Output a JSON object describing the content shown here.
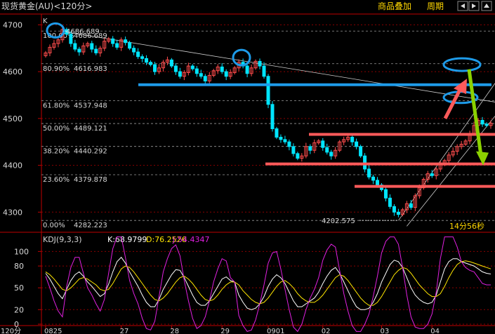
{
  "header": {
    "title": "现货黄金(AU)<120分>",
    "buttons": [
      "商品叠加",
      "周期"
    ],
    "nav_icons": [
      "arrow-left-icon",
      "arrow-right-icon",
      "arrow-up-icon"
    ]
  },
  "main_panel": {
    "corner_label": "K",
    "countdown": "14分56秒"
  },
  "colors": {
    "background": "#000000",
    "frame": "#c00000",
    "grid": "#8b0000",
    "candle_up": "#ff4d4d",
    "candle_down": "#00e5ff",
    "fib_line": "#9a9a9a",
    "axis_text": "#d8d8d8",
    "header_text": "#d8d8d8",
    "header_button": "#ffd700",
    "annotation_blue": "#1e9be9",
    "annotation_red": "#ff5a5a",
    "annotation_green": "#8bd100",
    "k_line": "#ffffff",
    "d_line": "#ffe600",
    "j_line": "#e020e0"
  },
  "chart_data": [
    {
      "type": "candlestick",
      "title": "现货黄金(AU)<120分>",
      "xlabel": "",
      "ylabel": "",
      "ylim": [
        4260,
        4720
      ],
      "y_ticks": [
        4300,
        4400,
        4500,
        4600,
        4700
      ],
      "x_ticks": [
        "0825",
        "27",
        "28",
        "29",
        "0901",
        "02",
        "03",
        "04"
      ],
      "period_label": "120分",
      "grid": true,
      "fibonacci_levels": [
        {
          "label": "100.00%",
          "value": 4686.689,
          "value_label": "4686.689"
        },
        {
          "label": "80.90%",
          "value": 4616.983,
          "value_label": "4616.983"
        },
        {
          "label": "61.80%",
          "value": 4537.948,
          "value_label": "4537.948"
        },
        {
          "label": "50.00%",
          "value": 4489.121,
          "value_label": "4489.121"
        },
        {
          "label": "38.20%",
          "value": 4440.292,
          "value_label": "4440.292"
        },
        {
          "label": "23.60%",
          "value": 4379.878,
          "value_label": "4379.878"
        },
        {
          "label": "0.00%",
          "value": 4282.223,
          "value_label": "4282.223"
        }
      ],
      "point_labels": [
        {
          "text": "4686.689",
          "value": 4686.689
        },
        {
          "text": "4202.575",
          "value": 4282.223
        }
      ],
      "series": [
        {
          "name": "",
          "close": [
            4640,
            4652,
            4660,
            4668,
            4690,
            4680,
            4660,
            4648,
            4642,
            4655,
            4660,
            4648,
            4640,
            4650,
            4665,
            4670,
            4660,
            4652,
            4668,
            4662,
            4650,
            4642,
            4632,
            4628,
            4620,
            4615,
            4600,
            4608,
            4620,
            4625,
            4612,
            4600,
            4590,
            4598,
            4612,
            4606,
            4596,
            4590,
            4580,
            4592,
            4602,
            4610,
            4600,
            4590,
            4598,
            4608,
            4620,
            4612,
            4596,
            4608,
            4622,
            4612,
            4590,
            4530,
            4478,
            4460,
            4455,
            4450,
            4440,
            4425,
            4415,
            4420,
            4440,
            4432,
            4448,
            4452,
            4438,
            4428,
            4420,
            4432,
            4450,
            4455,
            4460,
            4450,
            4440,
            4420,
            4392,
            4375,
            4368,
            4358,
            4348,
            4330,
            4312,
            4300,
            4295,
            4305,
            4318,
            4310,
            4335,
            4352,
            4370,
            4382,
            4378,
            4392,
            4402,
            4410,
            4422,
            4430,
            4440,
            4445,
            4452,
            4468,
            4485,
            4496,
            4488,
            4485,
            4490
          ]
        }
      ],
      "annotations": {
        "horizontal_levels": [
          {
            "color": "blue",
            "value": 4572
          },
          {
            "color": "red",
            "value": 4466
          },
          {
            "color": "red",
            "value": 4403
          },
          {
            "color": "red",
            "value": 4355
          }
        ],
        "ellipses": [
          {
            "color": "blue",
            "at": "100.00% level",
            "value": 4688
          },
          {
            "color": "blue",
            "at": "2nd high",
            "value": 4630
          },
          {
            "color": "blue",
            "at": "target upper",
            "value": 4615
          },
          {
            "color": "blue",
            "at": "target lower",
            "value": 4545
          }
        ],
        "arrows": [
          {
            "color": "red",
            "direction": "up",
            "from_value": 4500,
            "to_value": 4585
          },
          {
            "color": "green",
            "direction": "down",
            "from_value": 4605,
            "to_value": 4400
          }
        ]
      }
    },
    {
      "type": "line",
      "title": "KDJ(9,3,3)",
      "indicator_label": "KDJ(9,3,3)",
      "ylim": [
        0,
        110
      ],
      "y_ticks": [
        0,
        20,
        50,
        80,
        100
      ],
      "grid": true,
      "legend": [
        {
          "label": "K:",
          "value": "68.9799"
        },
        {
          "label": "D:",
          "value": "76.2526"
        },
        {
          "label": "J:",
          "value": "54.4347"
        }
      ],
      "series": [
        {
          "name": "K",
          "values": [
            70,
            62,
            52,
            42,
            35,
            48,
            60,
            68,
            72,
            66,
            58,
            52,
            45,
            38,
            42,
            55,
            72,
            86,
            92,
            84,
            72,
            62,
            52,
            40,
            30,
            24,
            24,
            34,
            48,
            58,
            68,
            75,
            74,
            64,
            52,
            40,
            30,
            26,
            26,
            32,
            42,
            52,
            62,
            65,
            60,
            58,
            40,
            30,
            22,
            20,
            22,
            28,
            38,
            52,
            62,
            68,
            64,
            56,
            44,
            32,
            24,
            24,
            28,
            32,
            36,
            44,
            56,
            66,
            74,
            78,
            70,
            58,
            46,
            34,
            24,
            20,
            20,
            22,
            30,
            42,
            58,
            70,
            82,
            88,
            86,
            78,
            64,
            50,
            40,
            34,
            30,
            28,
            30,
            40,
            58,
            76,
            86,
            90,
            90,
            86,
            84,
            82,
            80,
            76,
            72,
            70,
            69
          ]
        },
        {
          "name": "D",
          "values": [
            72,
            68,
            62,
            55,
            48,
            46,
            50,
            56,
            62,
            64,
            62,
            58,
            54,
            48,
            46,
            48,
            56,
            66,
            76,
            80,
            78,
            72,
            64,
            56,
            48,
            40,
            34,
            32,
            36,
            42,
            50,
            58,
            64,
            66,
            62,
            56,
            48,
            40,
            34,
            32,
            34,
            40,
            48,
            54,
            58,
            58,
            54,
            46,
            40,
            34,
            30,
            28,
            30,
            36,
            44,
            52,
            58,
            60,
            56,
            50,
            42,
            36,
            32,
            30,
            30,
            34,
            40,
            48,
            56,
            64,
            68,
            66,
            60,
            52,
            44,
            36,
            30,
            26,
            26,
            30,
            38,
            48,
            58,
            68,
            74,
            78,
            76,
            70,
            62,
            54,
            48,
            42,
            38,
            38,
            42,
            52,
            64,
            74,
            82,
            86,
            87,
            86,
            84,
            82,
            80,
            78,
            76
          ]
        },
        {
          "name": "J",
          "values": [
            66,
            50,
            32,
            18,
            10,
            52,
            78,
            92,
            92,
            70,
            50,
            40,
            28,
            18,
            34,
            70,
            104,
            126,
            124,
            92,
            60,
            42,
            28,
            8,
            -6,
            -8,
            4,
            38,
            72,
            90,
            104,
            109,
            94,
            60,
            32,
            8,
            -6,
            -2,
            10,
            32,
            58,
            76,
            90,
            87,
            64,
            58,
            12,
            -2,
            -14,
            -8,
            6,
            28,
            54,
            84,
            98,
            100,
            76,
            48,
            20,
            -4,
            -12,
            0,
            20,
            36,
            48,
            64,
            88,
            102,
            110,
            106,
            74,
            42,
            18,
            -2,
            -16,
            -12,
            0,
            14,
            38,
            66,
            98,
            114,
            130,
            128,
            110,
            78,
            40,
            10,
            -4,
            -6,
            -6,
            0,
            14,
            44,
            90,
            124,
            130,
            122,
            106,
            86,
            78,
            74,
            72,
            64,
            56,
            54,
            54
          ]
        }
      ]
    }
  ]
}
